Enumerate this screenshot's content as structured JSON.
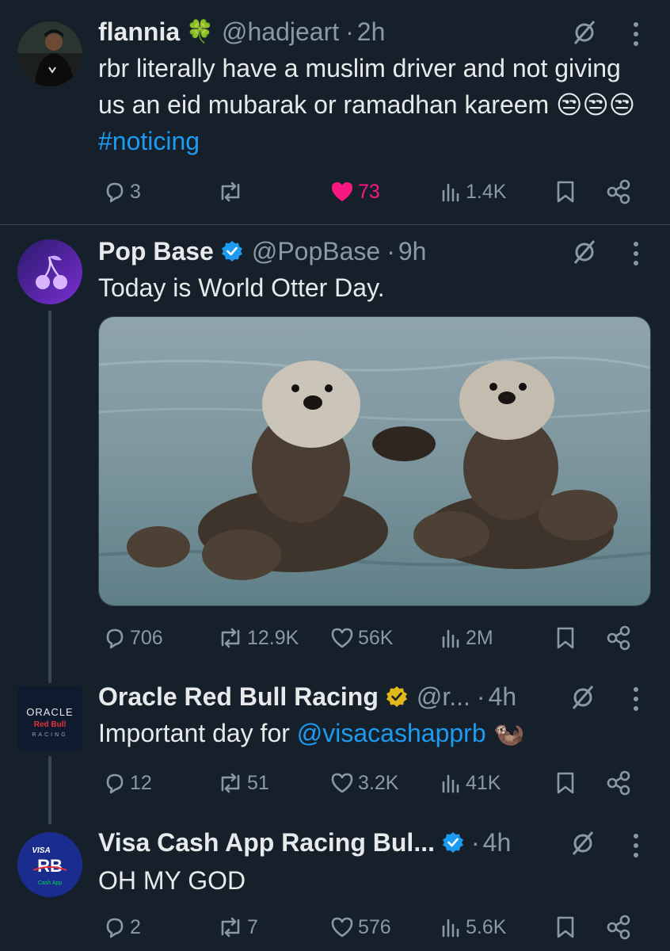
{
  "tweets": [
    {
      "name": "flannia",
      "name_emoji": "🍀",
      "handle": "@hadjeart",
      "time": "2h",
      "text": "rbr literally have a muslim driver and not giving us an eid mubarak or ramadhan kareem 😒😒😒",
      "hashtag": "#noticing",
      "replies": "3",
      "reposts": "",
      "likes": "73",
      "views": "1.4K",
      "liked": true
    },
    {
      "name": "Pop Base",
      "handle": "@PopBase",
      "time": "9h",
      "text": "Today is World Otter Day.",
      "media_alt": "two sea otters floating and holding paws",
      "replies": "706",
      "reposts": "12.9K",
      "likes": "56K",
      "views": "2M",
      "verified": "blue"
    },
    {
      "name": "Oracle Red Bull Racing",
      "handle": "@r...",
      "time": "4h",
      "text": "Important day for ",
      "mention": "@visacashapprb",
      "emoji": "🦦",
      "replies": "12",
      "reposts": "51",
      "likes": "3.2K",
      "views": "41K",
      "verified": "gold",
      "avatar_text": [
        "ORACLE",
        "Red Bull",
        "RACING"
      ]
    },
    {
      "name": "Visa Cash App Racing Bul...",
      "handle": "",
      "time": "4h",
      "text": "OH MY GOD",
      "replies": "2",
      "reposts": "7",
      "likes": "576",
      "views": "5.6K",
      "verified": "blue",
      "avatar_text": [
        "VISA",
        "RB",
        "Cash App"
      ]
    }
  ],
  "colors": {
    "background": "#15202b",
    "text": "#e7e9ea",
    "secondary": "#8b98a5",
    "link": "#1d9bf0",
    "like": "#f91880",
    "gold": "#e2b719"
  },
  "icons": [
    "reply-icon",
    "repost-icon",
    "like-icon",
    "views-icon",
    "bookmark-icon",
    "share-icon",
    "grok-icon",
    "more-icon",
    "verified-badge-icon"
  ]
}
